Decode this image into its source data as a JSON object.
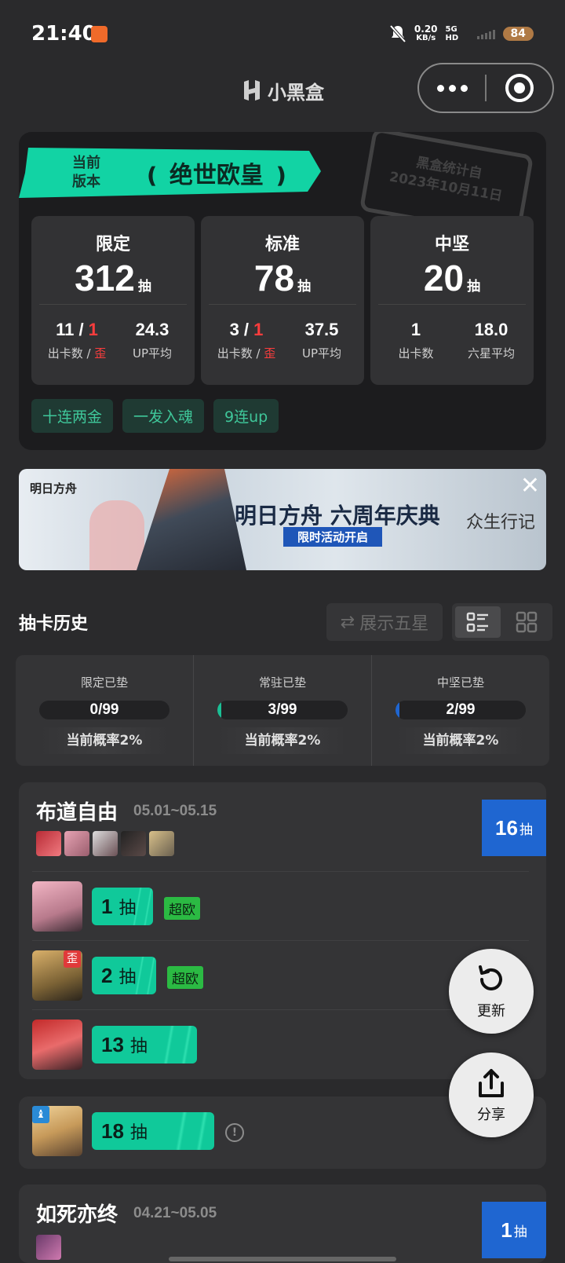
{
  "status_bar": {
    "time": "21:40",
    "speed_value": "0.20",
    "speed_unit": "KB/s",
    "network": "5G HD",
    "battery": "84"
  },
  "header": {
    "app_name": "小黑盒"
  },
  "summary": {
    "version_label_1": "当前",
    "version_label_2": "版本",
    "rank_title": "绝世欧皇",
    "stamp_line1": "黑盒统计自",
    "stamp_line2": "2023年10月11日",
    "stats": [
      {
        "name": "限定",
        "total": "312",
        "total_unit": "抽",
        "left_value_main": "11 / ",
        "left_value_red": "1",
        "left_label_main": "出卡数 / ",
        "left_label_red": "歪",
        "right_value": "24.3",
        "right_label": "UP平均"
      },
      {
        "name": "标准",
        "total": "78",
        "total_unit": "抽",
        "left_value_main": "3 / ",
        "left_value_red": "1",
        "left_label_main": "出卡数 / ",
        "left_label_red": "歪",
        "right_value": "37.5",
        "right_label": "UP平均"
      },
      {
        "name": "中坚",
        "total": "20",
        "total_unit": "抽",
        "left_value_main": "1",
        "left_value_red": "",
        "left_label_main": "出卡数",
        "left_label_red": "",
        "right_value": "18.0",
        "right_label": "六星平均"
      }
    ],
    "tags": [
      "十连两金",
      "一发入魂",
      "9连up"
    ]
  },
  "promo": {
    "brand": "明日方舟",
    "title": "明日方舟 六周年庆典",
    "badge": "限时活动开启",
    "signature": "众生行记"
  },
  "history": {
    "title": "抽卡历史",
    "toggle_label": "展示五星"
  },
  "pity": [
    {
      "label": "限定已垫",
      "value": "0/99",
      "fraction": 0.0,
      "prob": "当前概率2%"
    },
    {
      "label": "常驻已垫",
      "value": "3/99",
      "fraction": 0.03,
      "prob": "当前概率2%"
    },
    {
      "label": "中坚已垫",
      "value": "2/99",
      "fraction": 0.02,
      "prob": "当前概率2%"
    }
  ],
  "pools": [
    {
      "name": "布道自由",
      "date": "05.01~05.15",
      "count": "16",
      "count_unit": "抽",
      "pulls": [
        {
          "n": "1",
          "unit": "抽",
          "tag": "超欧"
        },
        {
          "n": "2",
          "unit": "抽",
          "tag": "超欧",
          "badge": "歪"
        },
        {
          "n": "13",
          "unit": "抽",
          "tag": ""
        }
      ]
    },
    {
      "name": "",
      "date": "",
      "pulls": [
        {
          "n": "18",
          "unit": "抽",
          "tag": "",
          "info": "!"
        }
      ]
    },
    {
      "name": "如死亦终",
      "date": "04.21~05.05",
      "count": "1",
      "count_unit": "抽"
    }
  ],
  "fab": {
    "refresh_label": "更新",
    "share_label": "分享"
  },
  "colors": {
    "accent_green": "#10c99a",
    "count_blue": "#1f66d1",
    "luck_green": "#2bba43",
    "warn_red": "#ff3d3d"
  }
}
